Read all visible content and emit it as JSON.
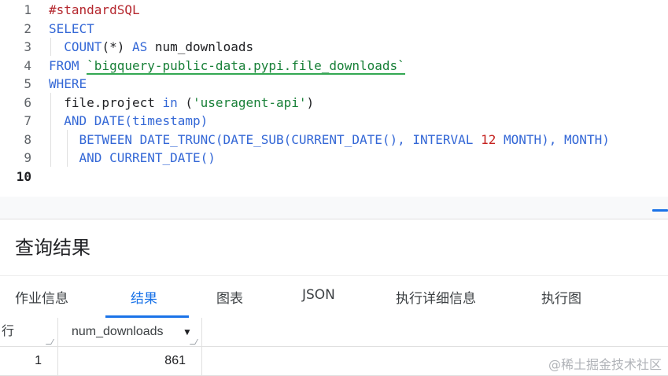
{
  "editor": {
    "line_numbers": [
      "1",
      "2",
      "3",
      "4",
      "5",
      "6",
      "7",
      "8",
      "9",
      "10"
    ],
    "lines": [
      [
        {
          "t": "#standardSQL",
          "c": "comment"
        }
      ],
      [
        {
          "t": "SELECT",
          "c": "kw"
        }
      ],
      [
        {
          "t": "  ",
          "c": "plain"
        },
        {
          "t": "COUNT",
          "c": "kw"
        },
        {
          "t": "(*) ",
          "c": "plain"
        },
        {
          "t": "AS",
          "c": "kw"
        },
        {
          "t": " num_downloads",
          "c": "plain"
        }
      ],
      [
        {
          "t": "FROM ",
          "c": "kw"
        },
        {
          "t": "`bigquery-public-data.pypi.file_downloads`",
          "c": "table"
        }
      ],
      [
        {
          "t": "WHERE",
          "c": "kw"
        }
      ],
      [
        {
          "t": "  file.project ",
          "c": "plain"
        },
        {
          "t": "in",
          "c": "kw"
        },
        {
          "t": " (",
          "c": "plain"
        },
        {
          "t": "'useragent-api'",
          "c": "str"
        },
        {
          "t": ")",
          "c": "plain"
        }
      ],
      [
        {
          "t": "  ",
          "c": "plain"
        },
        {
          "t": "AND DATE",
          "c": "kw"
        },
        {
          "t": "(",
          "c": "kw"
        },
        {
          "t": "timestamp",
          "c": "kw"
        },
        {
          "t": ")",
          "c": "kw"
        }
      ],
      [
        {
          "t": "    ",
          "c": "plain"
        },
        {
          "t": "BETWEEN DATE_TRUNC(DATE_SUB(CURRENT_DATE(), INTERVAL ",
          "c": "kw"
        },
        {
          "t": "12",
          "c": "num"
        },
        {
          "t": " MONTH), MONTH)",
          "c": "kw"
        }
      ],
      [
        {
          "t": "    ",
          "c": "plain"
        },
        {
          "t": "AND CURRENT_DATE()",
          "c": "kw"
        }
      ],
      [
        {
          "t": "",
          "c": "plain"
        }
      ]
    ]
  },
  "results": {
    "title": "查询结果",
    "tabs": [
      "作业信息",
      "结果",
      "图表",
      "JSON",
      "执行详细信息",
      "执行图"
    ],
    "active_tab": "结果",
    "columns": {
      "row_header": "行",
      "col1": "num_downloads"
    },
    "rows": [
      {
        "row": "1",
        "num_downloads": "861"
      }
    ]
  },
  "watermark": "@稀土掘金技术社区",
  "colors": {
    "keyword": "#3367d6",
    "string": "#188038",
    "comment": "#b5282f",
    "accent": "#1a73e8"
  },
  "icons": {
    "sort": "sort-down-icon"
  }
}
